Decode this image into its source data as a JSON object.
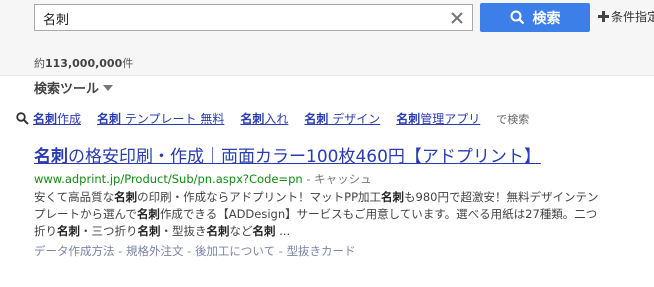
{
  "search": {
    "query": "名刺",
    "button_label": "検索",
    "advanced_label": "条件指定"
  },
  "result_count": {
    "prefix": "約",
    "number": "113,000,000",
    "suffix": "件"
  },
  "tools_label": "検索ツール",
  "related": {
    "items": [
      {
        "bold": "名刺",
        "rest": "作成"
      },
      {
        "bold": "名刺",
        "rest": " テンプレート 無料"
      },
      {
        "bold": "名刺",
        "rest": "入れ"
      },
      {
        "bold": "名刺",
        "rest": " デザイン"
      },
      {
        "bold": "名刺",
        "rest": "管理アプリ"
      }
    ],
    "suffix": "で検索"
  },
  "result": {
    "title_bold": "名刺",
    "title_rest": "の格安印刷・作成｜両面カラー100枚460円【アドプリント】",
    "url": "www.adprint.jp/Product/Sub/pn.aspx?Code=pn",
    "url_sep": " - ",
    "cache_label": "キャッシュ",
    "snippet": [
      {
        "t": "安くて高品質な",
        "b": false
      },
      {
        "t": "名刺",
        "b": true
      },
      {
        "t": "の印刷・作成ならアドプリント！マットPP加工",
        "b": false
      },
      {
        "t": "名刺",
        "b": true
      },
      {
        "t": "も980円で超激安！無料デザインテンプレートから選んで",
        "b": false
      },
      {
        "t": "名刺",
        "b": true
      },
      {
        "t": "作成できる【ADDesign】サービスもご用意しています。選べる用紙は27種類。二つ折り",
        "b": false
      },
      {
        "t": "名刺",
        "b": true
      },
      {
        "t": "・三つ折り",
        "b": false
      },
      {
        "t": "名刺",
        "b": true
      },
      {
        "t": "・型抜き",
        "b": false
      },
      {
        "t": "名刺",
        "b": true
      },
      {
        "t": "など",
        "b": false
      },
      {
        "t": "名刺",
        "b": true
      },
      {
        "t": " ...",
        "b": false
      }
    ],
    "sitelinks": [
      "データ作成方法",
      "規格外注文",
      "後加工について",
      "型抜きカード"
    ],
    "sitelink_sep": " - "
  },
  "colors": {
    "link": "#2a3db0",
    "url": "#128a12",
    "button": "#3d7fe8"
  }
}
